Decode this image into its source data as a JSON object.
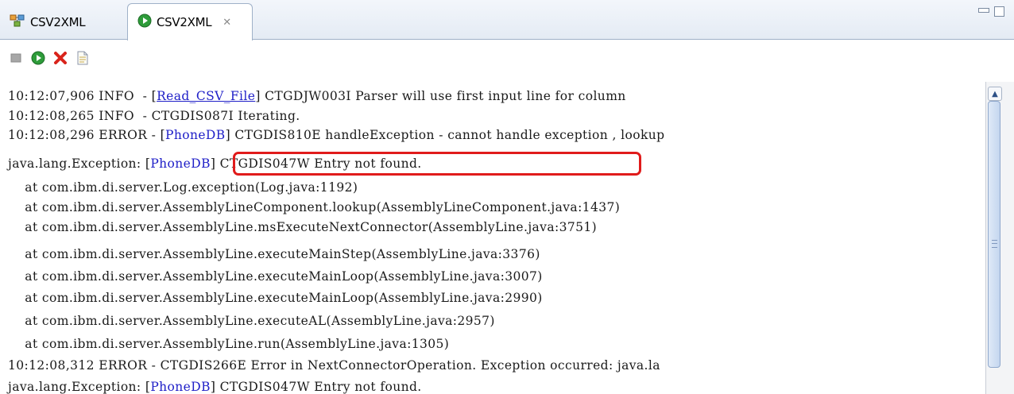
{
  "tabs": [
    {
      "label": "CSV2XML",
      "active": false,
      "icon": "assembly-line-icon"
    },
    {
      "label": "CSV2XML",
      "active": true,
      "icon": "run-icon",
      "close": "✕"
    }
  ],
  "toolbar": {
    "buttons": [
      {
        "icon": "stop-icon",
        "enabled": false
      },
      {
        "icon": "run-icon"
      },
      {
        "icon": "close-red-x-icon"
      },
      {
        "icon": "document-icon"
      }
    ]
  },
  "console": {
    "lines": [
      {
        "prefix": "10:12:07,906 INFO  - [",
        "link": "Read_CSV_File",
        "suffix": "] CTGDJW003I Parser will use first input line for column"
      },
      {
        "text": "10:12:08,265 INFO  - CTGDIS087I Iterating."
      },
      {
        "prefix": "10:12:08,296 ERROR - [",
        "blue": "PhoneDB",
        "suffix": "] CTGDIS810E handleException - cannot handle exception , lookup"
      },
      {
        "prefix": "java.lang.Exception: [",
        "blue": "PhoneDB",
        "suffix": "] CTGDIS047W Entry not found."
      },
      {
        "text": "    at com.ibm.di.server.Log.exception(Log.java:1192)"
      },
      {
        "text": "    at com.ibm.di.server.AssemblyLineComponent.lookup(AssemblyLineComponent.java:1437)"
      },
      {
        "text": "    at com.ibm.di.server.AssemblyLine.msExecuteNextConnector(AssemblyLine.java:3751)"
      },
      {
        "text": "    at com.ibm.di.server.AssemblyLine.executeMainStep(AssemblyLine.java:3376)"
      },
      {
        "text": "    at com.ibm.di.server.AssemblyLine.executeMainLoop(AssemblyLine.java:3007)"
      },
      {
        "text": "    at com.ibm.di.server.AssemblyLine.executeMainLoop(AssemblyLine.java:2990)"
      },
      {
        "text": "    at com.ibm.di.server.AssemblyLine.executeAL(AssemblyLine.java:2957)"
      },
      {
        "text": "    at com.ibm.di.server.AssemblyLine.run(AssemblyLine.java:1305)"
      },
      {
        "text": "10:12:08,312 ERROR - CTGDIS266E Error in NextConnectorOperation. Exception occurred: java.la"
      },
      {
        "prefix": "java.lang.Exception: [",
        "blue": "PhoneDB",
        "suffix": "] CTGDIS047W Entry not found."
      }
    ]
  },
  "colors": {
    "link_blue": "#2020c8",
    "highlight_red": "#e01b1b"
  }
}
